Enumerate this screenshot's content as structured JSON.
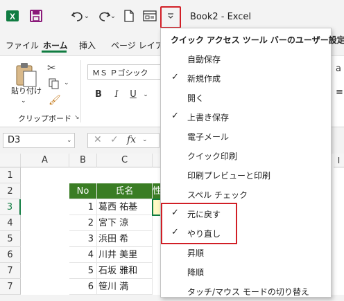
{
  "window": {
    "title": "Book2  -  Excel"
  },
  "qat": {
    "icons": [
      "excel-logo-icon",
      "save-icon",
      "undo-icon",
      "redo-icon",
      "new-file-icon",
      "form-icon",
      "customize-qat-icon"
    ]
  },
  "tabs": [
    "ファイル",
    "ホーム",
    "挿入",
    "ページ レイアウト"
  ],
  "ribbon": {
    "paste_label": "貼り付け",
    "clipboard_label": "クリップボード",
    "font_name": "ＭＳ Ｐゴシック",
    "bold": "B",
    "italic": "I",
    "underline": "U"
  },
  "formula_bar": {
    "name_box": "D3",
    "fx": "fx"
  },
  "grid": {
    "columns": [
      "A",
      "B",
      "C"
    ],
    "rows": [
      "1",
      "2",
      "3",
      "4",
      "5",
      "6",
      "7"
    ],
    "header": {
      "no": "No",
      "name": "氏名",
      "partial": "性"
    },
    "data": [
      {
        "no": "1",
        "name": "葛西 祐基"
      },
      {
        "no": "2",
        "name": "宮下 涼"
      },
      {
        "no": "3",
        "name": "浜田 希"
      },
      {
        "no": "4",
        "name": "川井 美里"
      },
      {
        "no": "5",
        "name": "石坂 雅和"
      },
      {
        "no": "6",
        "name": "笹川 満"
      }
    ],
    "header_color": "#3a7d24"
  },
  "menu": {
    "title": "クイック アクセス ツール バーのユーザー設定",
    "items": [
      {
        "label": "自動保存",
        "checked": false
      },
      {
        "label": "新規作成",
        "checked": true
      },
      {
        "label": "開く",
        "checked": false
      },
      {
        "label": "上書き保存",
        "checked": true
      },
      {
        "label": "電子メール",
        "checked": false
      },
      {
        "label": "クイック印刷",
        "checked": false
      },
      {
        "label": "印刷プレビューと印刷",
        "checked": false
      },
      {
        "label": "スペル チェック",
        "checked": false
      },
      {
        "label": "元に戻す",
        "checked": true
      },
      {
        "label": "やり直し",
        "checked": true
      },
      {
        "label": "昇順",
        "checked": false
      },
      {
        "label": "降順",
        "checked": false
      },
      {
        "label": "タッチ/マウス モードの切り替え",
        "checked": false
      }
    ],
    "check_glyph": "✓",
    "highlight_color": "#d11f26"
  }
}
